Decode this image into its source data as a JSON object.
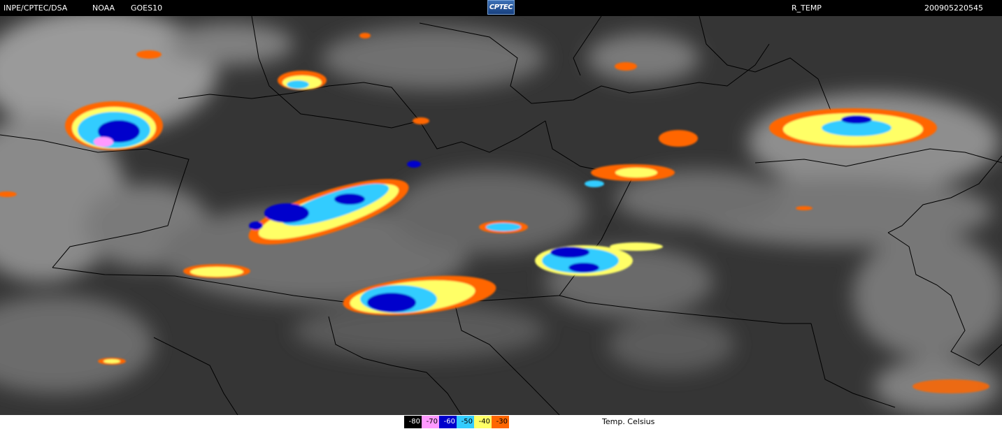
{
  "header": {
    "source": "INPE/CPTEC/DSA",
    "agency": "NOAA",
    "satellite": "GOES10",
    "logo_text": "CPTEC",
    "product": "R_TEMP",
    "timestamp": "200905220545"
  },
  "legend": {
    "unit_label": "Temp. Celsius",
    "colors": {
      "-80": "#000000",
      "-70": "#ff99ff",
      "-60": "#0000cc",
      "-50": "#33ccff",
      "-40": "#ffff66",
      "-30": "#ff6600"
    },
    "swatches": [
      {
        "label": "-80",
        "color": "#000000"
      },
      {
        "label": "-70",
        "color": "#ff99ff"
      },
      {
        "label": "-60",
        "color": "#0000cc"
      },
      {
        "label": "-50",
        "color": "#33ccff"
      },
      {
        "label": "-40",
        "color": "#ffff66"
      },
      {
        "label": "-30",
        "color": "#ff6600"
      }
    ]
  }
}
